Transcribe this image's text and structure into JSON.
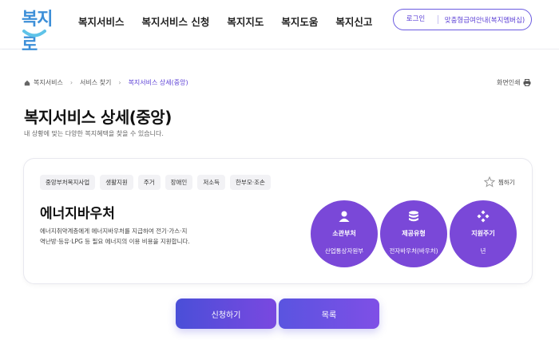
{
  "header": {
    "logo_text": "복지로",
    "nav": [
      "복지서비스",
      "복지서비스 신청",
      "복지지도",
      "복지도움",
      "복지신고"
    ],
    "util": {
      "login": "로그인",
      "guide": "맞춤형급여안내(복지멤버십)"
    }
  },
  "breadcrumb": {
    "items": [
      "복지서비스",
      "서비스 찾기",
      "복지서비스 상세(중앙)"
    ],
    "print_label": "화면인쇄"
  },
  "page": {
    "title": "복지서비스 상세(중앙)",
    "description": "내 상황에 맞는 다양한 복지혜택을 찾을 수 있습니다."
  },
  "card": {
    "tags": [
      "중앙부처복지사업",
      "생활지원",
      "주거",
      "장애인",
      "저소득",
      "한부모·조손"
    ],
    "bookmark_label": "찜하기",
    "service_title": "에너지바우처",
    "service_desc_line1": "에너지취약계층에게 에너지바우처를 지급하여 전기·가스·지",
    "service_desc_line2": "역난방·등유·LPG 등 필요 에너지의 이용 비용을 지원합니다.",
    "info": [
      {
        "label": "소관부처",
        "value": "산업통상자원부",
        "icon": "person-icon"
      },
      {
        "label": "제공유형",
        "value": "전자바우처(바우처)",
        "icon": "coins-icon"
      },
      {
        "label": "지원주기",
        "value": "년",
        "icon": "cycle-icon"
      }
    ]
  },
  "actions": {
    "apply": "신청하기",
    "list": "목록"
  },
  "colors": {
    "accent": "#7a48d8",
    "brand_logo": "#3d8fd8",
    "link": "#5b3fd6"
  }
}
